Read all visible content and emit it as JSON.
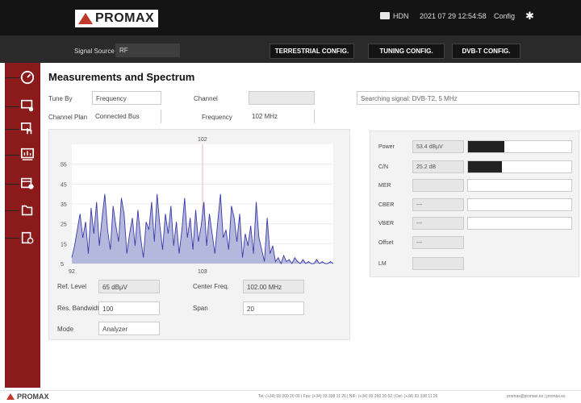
{
  "header": {
    "logo": "PROMAX",
    "folder_label": "HDN",
    "datetime": "2021 07 29 12:54:58",
    "config_label": "Config"
  },
  "toolbar": {
    "signal_source_label": "Signal Source",
    "signal_source_value": "RF",
    "buttons": [
      "TERRESTRIAL CONFIG.",
      "TUNING CONFIG.",
      "DVB-T CONFIG."
    ]
  },
  "sidebar": {
    "icons": [
      "speedometer-icon",
      "screen-settings-icon",
      "touch-icon",
      "spectrum-icon",
      "calendar-icon",
      "folder-icon",
      "clipboard-clock-icon"
    ]
  },
  "page": {
    "title": "Measurements and Spectrum"
  },
  "tuning": {
    "tune_by_label": "Tune By",
    "tune_by_value": "Frequency",
    "channel_label": "Channel",
    "channel_value": "",
    "status_text": "Searching signal: DVB-T2, 5 MHz",
    "channel_plan_label": "Channel Plan",
    "channel_plan_value": "Connected Bus",
    "frequency_label": "Frequency",
    "frequency_value": "102 MHz"
  },
  "chart_data": {
    "type": "area",
    "x_label_left": "92",
    "x_label_mid": "102",
    "x_label_bottom_mid": "103",
    "yticks": [
      "55",
      "45",
      "35",
      "25",
      "15",
      "5"
    ],
    "ylim": [
      5,
      65
    ],
    "color": "#3a3aa8",
    "fill": "#b5b8dd",
    "values": [
      8,
      14,
      22,
      30,
      18,
      26,
      10,
      33,
      20,
      36,
      14,
      28,
      40,
      22,
      12,
      34,
      24,
      16,
      38,
      30,
      10,
      20,
      28,
      14,
      32,
      18,
      8,
      26,
      22,
      36,
      16,
      40,
      24,
      12,
      30,
      20,
      34,
      14,
      26,
      10,
      22,
      38,
      18,
      28,
      12,
      32,
      16,
      24,
      36,
      14,
      30,
      20,
      10,
      26,
      40,
      18,
      22,
      12,
      34,
      28,
      16,
      30,
      8,
      20,
      14,
      24,
      10,
      36,
      18,
      12,
      6,
      28,
      10,
      14,
      6,
      8,
      5,
      9,
      6,
      7,
      5,
      8,
      6,
      5,
      7,
      5,
      6,
      5,
      5,
      7,
      5,
      6,
      5,
      5,
      6,
      5
    ]
  },
  "spectrum_params": {
    "ref_level_label": "Ref. Level",
    "ref_level_value": "65 dBµV",
    "center_freq_label": "Center Freq.",
    "center_freq_value": "102.00 MHz",
    "res_bw_label": "Res. Bandwidth",
    "res_bw_value": "100",
    "span_label": "Span",
    "span_value": "20",
    "mode_label": "Mode",
    "mode_value": "Analyzer"
  },
  "measurements": [
    {
      "label": "Power",
      "value": "53.4 dBµV",
      "level": 0.35
    },
    {
      "label": "C/N",
      "value": "25.2 dB",
      "level": 0.33
    },
    {
      "label": "MER",
      "value": "",
      "level": 0
    },
    {
      "label": "CBER",
      "value": "---",
      "level": 0
    },
    {
      "label": "VBER",
      "value": "---",
      "level": 0
    },
    {
      "label": "Offset",
      "value": "---",
      "level": null
    },
    {
      "label": "LM",
      "value": "",
      "level": null
    }
  ],
  "footer": {
    "logo": "PROMAX",
    "contact": "Tel: (+34) 93 260 20 00  |  Fax: (+34) 93 338 11 26  |  NIF: (+34) 93 260 20 02  |  Del: (+34) 93 338 11 26",
    "email": "promax@promax.es  |  promax.es"
  },
  "colors": {
    "sidebar": "#8b1a1a",
    "topbar": "#141414",
    "accent": "#c0392b"
  }
}
